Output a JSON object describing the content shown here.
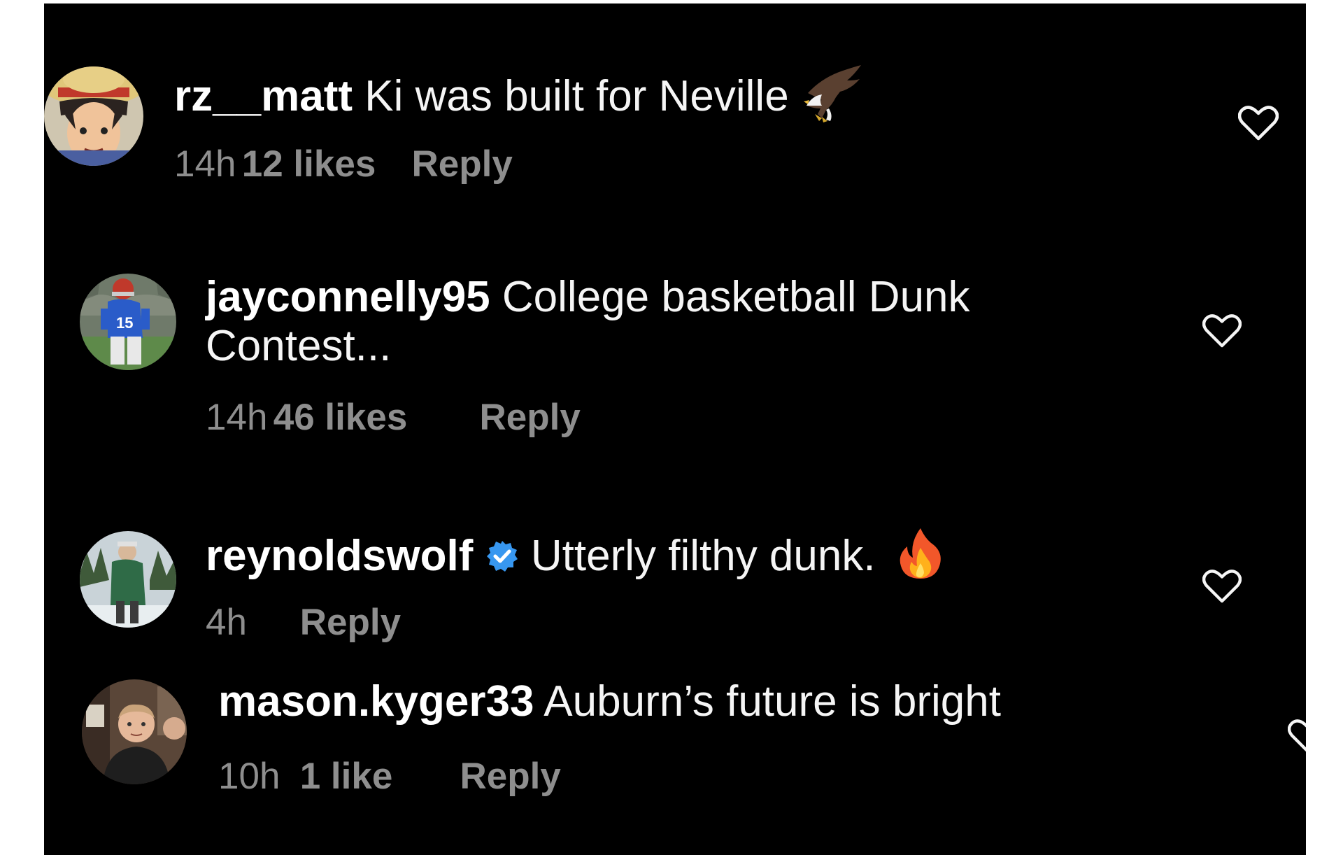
{
  "comments": [
    {
      "username": "rz__matt",
      "text": "Ki was built for Neville",
      "emoji": "eagle-emoji",
      "time": "14h",
      "likes": "12 likes",
      "reply": "Reply"
    },
    {
      "username": "jayconnelly95",
      "text_line1": "College basketball Dunk",
      "text_line2": "Contest...",
      "time": "14h",
      "likes": "46 likes",
      "reply": "Reply"
    },
    {
      "username": "reynoldswolf",
      "verified": true,
      "text": "Utterly filthy dunk.",
      "emoji": "fire-emoji",
      "time": "4h",
      "reply": "Reply"
    },
    {
      "username": "mason.kyger33",
      "text": "Auburn’s future is bright",
      "time": "10h",
      "likes": "1 like",
      "reply": "Reply"
    }
  ],
  "colors": {
    "background": "#000000",
    "primary_text": "#f5f5f5",
    "secondary_text": "#8e8e8e",
    "verified_badge": "#3797f0"
  }
}
